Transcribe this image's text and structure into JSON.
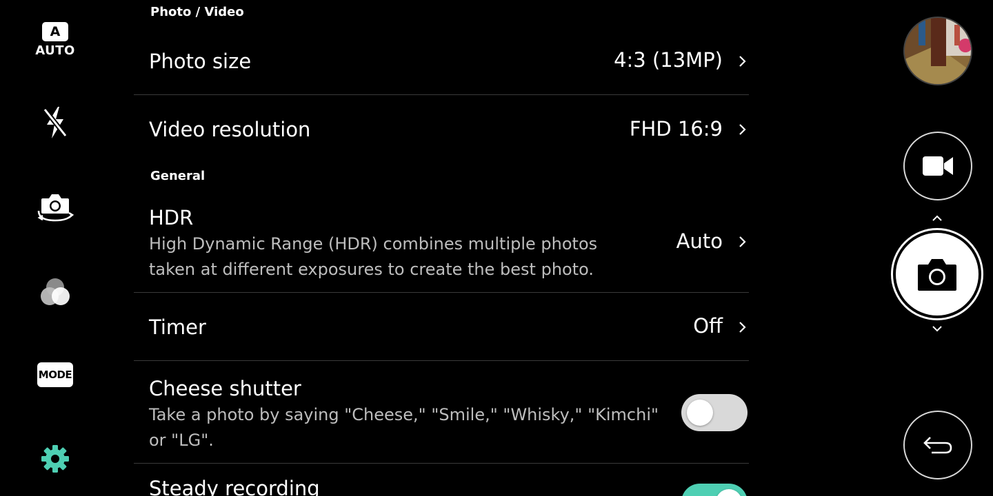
{
  "colors": {
    "accent": "#4ecfb3",
    "background": "#000000",
    "secondary_text": "#bdbdbd"
  },
  "left_bar": {
    "auto_badge_letter": "A",
    "auto_label": "AUTO",
    "mode_label": "MODE",
    "icons": [
      "flash-off-icon",
      "switch-camera-icon",
      "filter-icon",
      "settings-gear-icon"
    ]
  },
  "sections": {
    "photo_video": "Photo / Video",
    "general": "General"
  },
  "rows": {
    "photo_size": {
      "title": "Photo size",
      "value": "4:3 (13MP)"
    },
    "video_resolution": {
      "title": "Video resolution",
      "value": "FHD 16:9"
    },
    "hdr": {
      "title": "HDR",
      "description": "High Dynamic Range (HDR) combines multiple photos taken at different exposures to create the best photo.",
      "value": "Auto"
    },
    "timer": {
      "title": "Timer",
      "value": "Off"
    },
    "cheese_shutter": {
      "title": "Cheese shutter",
      "description": "Take a photo by saying \"Cheese,\" \"Smile,\" \"Whisky,\" \"Kimchi\" or \"LG\".",
      "enabled": false
    },
    "steady_recording": {
      "title": "Steady recording",
      "enabled": true
    }
  },
  "right_bar": {
    "icons": [
      "gallery-thumbnail",
      "video-record-icon",
      "shutter-camera-icon",
      "back-arrow-icon"
    ]
  }
}
